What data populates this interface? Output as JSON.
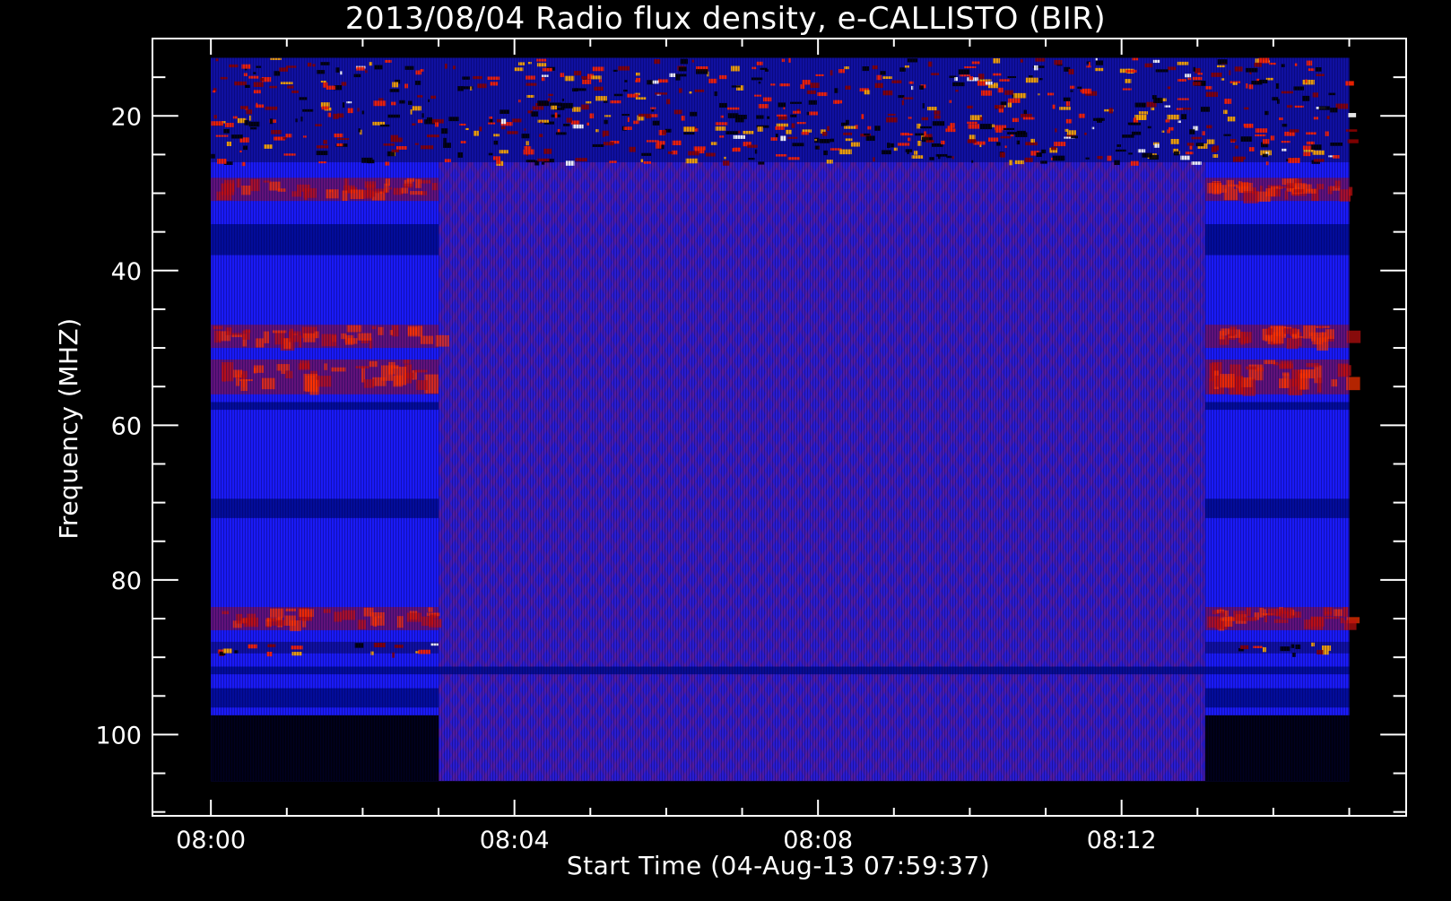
{
  "chart_data": {
    "type": "heatmap",
    "title": "2013/08/04  Radio flux density, e-CALLISTO (BIR)",
    "xlabel": "Start Time (04-Aug-13 07:59:37)",
    "ylabel": "Frequency (MHZ)",
    "x_ticks": [
      {
        "value": 0,
        "label": "08:00"
      },
      {
        "value": 4,
        "label": "08:04"
      },
      {
        "value": 8,
        "label": "08:08"
      },
      {
        "value": 12,
        "label": "08:12"
      }
    ],
    "x_minor_step": 1,
    "xlim": [
      -0.77,
      15.75
    ],
    "data_xlim": [
      0,
      15.0
    ],
    "y_ticks": [
      {
        "value": 20,
        "label": "20"
      },
      {
        "value": 40,
        "label": "40"
      },
      {
        "value": 60,
        "label": "60"
      },
      {
        "value": 80,
        "label": "80"
      },
      {
        "value": 100,
        "label": "100"
      }
    ],
    "y_minor_step": 5,
    "ylim": [
      10.0,
      110.5
    ],
    "y_inverted": true,
    "data_ylim": [
      12.5,
      106.0
    ],
    "colormap": [
      "#000000",
      "#0000ff",
      "#8b0000",
      "#ff2200",
      "#ffcc00",
      "#ffffff"
    ],
    "background_segments": [
      {
        "t0": 0,
        "t1": 3.0,
        "state": "quiet"
      },
      {
        "t0": 3.0,
        "t1": 13.1,
        "state": "interference"
      },
      {
        "t0": 13.1,
        "t1": 15.0,
        "state": "quiet"
      }
    ],
    "bands": [
      {
        "f0": 12.5,
        "f1": 26.0,
        "intensity": "high",
        "region": "all"
      },
      {
        "f0": 28.0,
        "f1": 31.0,
        "intensity": "medium",
        "region": "quiet"
      },
      {
        "f0": 34.0,
        "f1": 38.0,
        "intensity": "low",
        "region": "quiet"
      },
      {
        "f0": 47.0,
        "f1": 50.0,
        "intensity": "medium",
        "region": "quiet"
      },
      {
        "f0": 51.5,
        "f1": 56.0,
        "intensity": "medium",
        "region": "quiet"
      },
      {
        "f0": 57.0,
        "f1": 58.0,
        "intensity": "low",
        "region": "quiet"
      },
      {
        "f0": 69.5,
        "f1": 72.0,
        "intensity": "low",
        "region": "quiet"
      },
      {
        "f0": 83.5,
        "f1": 86.5,
        "intensity": "medium",
        "region": "quiet"
      },
      {
        "f0": 88.0,
        "f1": 89.5,
        "intensity": "high",
        "region": "quiet"
      },
      {
        "f0": 91.2,
        "f1": 92.2,
        "intensity": "low",
        "region": "all"
      },
      {
        "f0": 94.0,
        "f1": 96.5,
        "intensity": "low",
        "region": "quiet"
      },
      {
        "f0": 97.5,
        "f1": 106.0,
        "intensity": "none",
        "region": "quiet"
      }
    ]
  }
}
